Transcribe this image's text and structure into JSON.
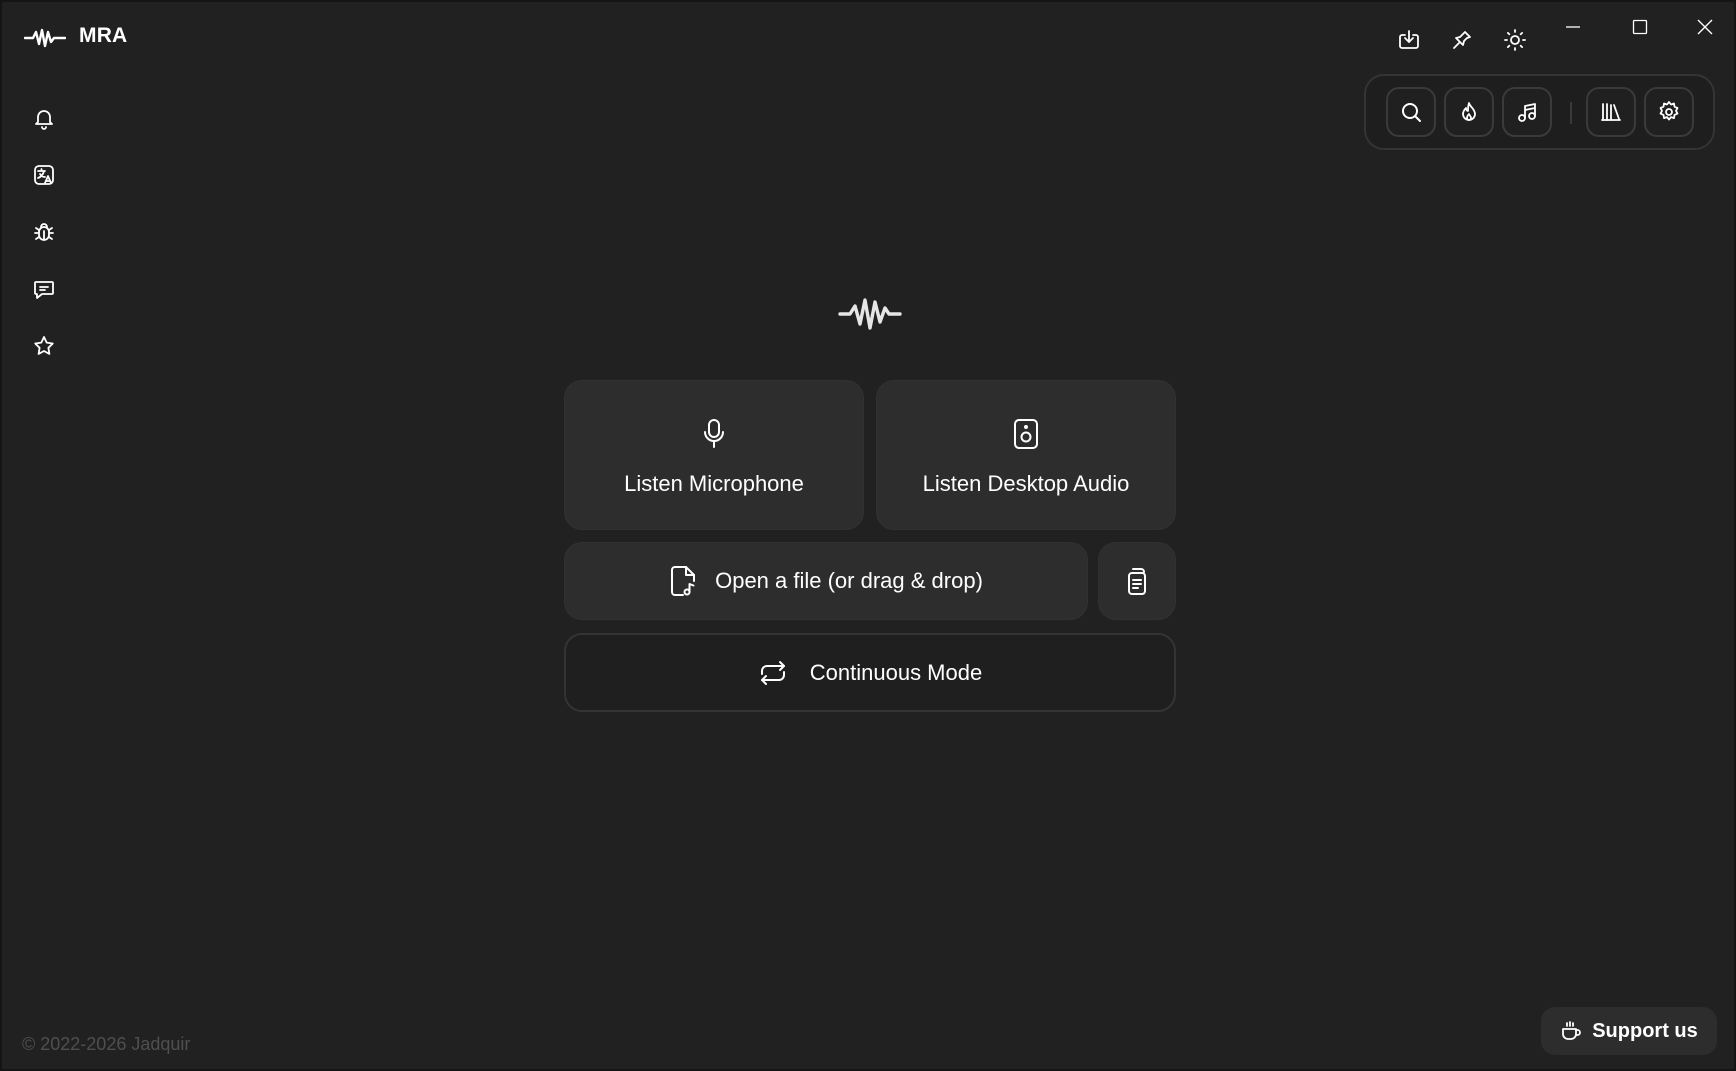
{
  "app": {
    "title": "MRA",
    "logo_icon": "waveform-icon"
  },
  "titlebar": {
    "actions": [
      {
        "name": "download-icon"
      },
      {
        "name": "pin-icon"
      },
      {
        "name": "sun-icon"
      }
    ],
    "window_controls": [
      {
        "name": "minimize-icon"
      },
      {
        "name": "maximize-icon"
      },
      {
        "name": "close-icon"
      }
    ]
  },
  "sidebar": {
    "items": [
      {
        "name": "bell-icon"
      },
      {
        "name": "translate-icon"
      },
      {
        "name": "bug-icon"
      },
      {
        "name": "message-icon"
      },
      {
        "name": "star-icon"
      }
    ]
  },
  "toolbar": {
    "buttons": [
      {
        "name": "search-icon"
      },
      {
        "name": "flame-icon"
      },
      {
        "name": "music-note-icon"
      },
      {
        "name": "library-icon"
      },
      {
        "name": "gear-icon"
      }
    ]
  },
  "main": {
    "listen_microphone": "Listen Microphone",
    "listen_desktop_audio": "Listen Desktop Audio",
    "open_file": "Open a file (or drag & drop)",
    "continuous_mode": "Continuous Mode"
  },
  "footer": {
    "copyright": "© 2022-2026 Jadquir",
    "support_label": "Support us"
  },
  "colors": {
    "background": "#212121",
    "card": "#2d2d2e",
    "border": "#343434",
    "text": "#ffffff",
    "muted_text": "#4f4f4f"
  }
}
